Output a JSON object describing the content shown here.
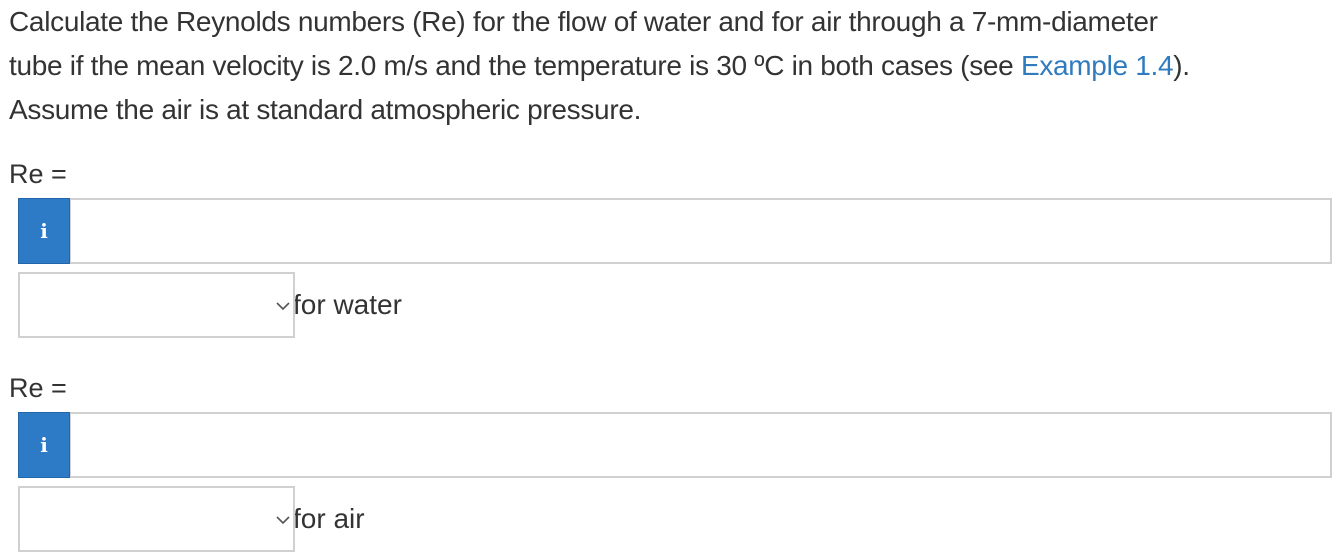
{
  "question": {
    "line1": "Calculate the Reynolds numbers (Re) for the flow of water and for air through a 7-mm-diameter",
    "line2_before_link": "tube if the mean velocity is 2.0 m/s and the temperature is 30 ºC in both cases (see ",
    "link_text": "Example 1.4",
    "line2_after_link": ").",
    "line3": "Assume the air is at standard atmospheric pressure."
  },
  "parts": [
    {
      "label": "Re =",
      "info_icon": "i",
      "input_value": "",
      "select_value": "",
      "suffix": "for water"
    },
    {
      "label": "Re =",
      "info_icon": "i",
      "input_value": "",
      "select_value": "",
      "suffix": "for air"
    }
  ],
  "colors": {
    "link": "#2f7bbd",
    "info_button": "#2d7bc7",
    "text": "#333333",
    "border": "#d0d0d0"
  },
  "icons": {
    "info_button": "info-icon",
    "dropdown": "chevron-down-icon"
  }
}
